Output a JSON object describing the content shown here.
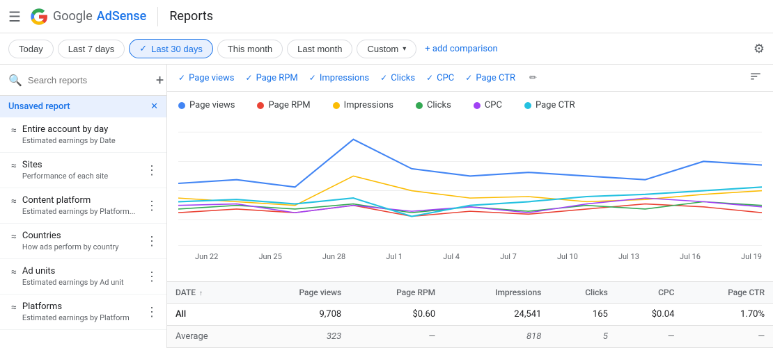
{
  "topbar": {
    "menu_icon": "☰",
    "logo_alt": "Google",
    "product": "AdSense",
    "divider": "|",
    "title": "Reports"
  },
  "filterbar": {
    "buttons": [
      {
        "label": "Today",
        "active": false
      },
      {
        "label": "Last 7 days",
        "active": false
      },
      {
        "label": "Last 30 days",
        "active": true
      },
      {
        "label": "This month",
        "active": false
      },
      {
        "label": "Last month",
        "active": false
      },
      {
        "label": "Custom",
        "active": false,
        "has_arrow": true
      }
    ],
    "add_comparison": "+ add comparison",
    "settings_icon": "⚙"
  },
  "sidebar": {
    "search_placeholder": "Search reports",
    "active_item": "Unsaved report",
    "items": [
      {
        "icon": "≈",
        "title": "Entire account by day",
        "subtitle": "Estimated earnings by Date"
      },
      {
        "icon": "≈",
        "title": "Sites",
        "subtitle": "Performance of each site"
      },
      {
        "icon": "≈",
        "title": "Content platform",
        "subtitle": "Estimated earnings by Platform..."
      },
      {
        "icon": "≈",
        "title": "Countries",
        "subtitle": "How ads perform by country"
      },
      {
        "icon": "≈",
        "title": "Ad units",
        "subtitle": "Estimated earnings by Ad unit"
      },
      {
        "icon": "≈",
        "title": "Platforms",
        "subtitle": "Estimated earnings by Platform"
      }
    ]
  },
  "metrics": {
    "tabs": [
      {
        "label": "Page views",
        "checked": true
      },
      {
        "label": "Page RPM",
        "checked": true
      },
      {
        "label": "Impressions",
        "checked": true
      },
      {
        "label": "Clicks",
        "checked": true
      },
      {
        "label": "CPC",
        "checked": true
      },
      {
        "label": "Page CTR",
        "checked": true
      }
    ]
  },
  "legend": [
    {
      "label": "Page views",
      "color": "#4285f4"
    },
    {
      "label": "Page RPM",
      "color": "#ea4335"
    },
    {
      "label": "Impressions",
      "color": "#fbbc04"
    },
    {
      "label": "Clicks",
      "color": "#34a853"
    },
    {
      "label": "CPC",
      "color": "#a142f4"
    },
    {
      "label": "Page CTR",
      "color": "#24c1e0"
    }
  ],
  "chart": {
    "x_labels": [
      "Jun 22",
      "Jun 25",
      "Jun 28",
      "Jul 1",
      "Jul 4",
      "Jul 7",
      "Jul 10",
      "Jul 13",
      "Jul 16",
      "Jul 19"
    ]
  },
  "table": {
    "columns": [
      "DATE",
      "Page views",
      "Page RPM",
      "Impressions",
      "Clicks",
      "CPC",
      "Page CTR"
    ],
    "rows": [
      {
        "label": "All",
        "page_views": "9,708",
        "page_rpm": "$0.60",
        "impressions": "24,541",
        "clicks": "165",
        "cpc": "$0.04",
        "page_ctr": "1.70%"
      },
      {
        "label": "Average",
        "page_views": "323",
        "page_rpm": "—",
        "impressions": "818",
        "clicks": "5",
        "cpc": "—",
        "page_ctr": "—"
      }
    ]
  }
}
